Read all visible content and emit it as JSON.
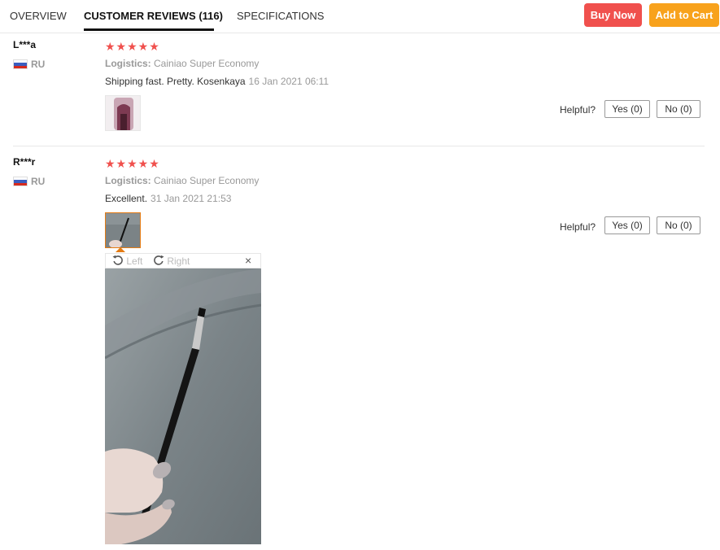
{
  "tabs": [
    {
      "label": "OVERVIEW",
      "active": false
    },
    {
      "label": "CUSTOMER REVIEWS (116)",
      "active": true
    },
    {
      "label": "SPECIFICATIONS",
      "active": false
    }
  ],
  "actions": {
    "buy_now": "Buy Now",
    "add_to_cart": "Add to Cart"
  },
  "colors": {
    "buy_now": "#f0504d",
    "add_to_cart": "#f8a21c",
    "stars": "#f0504d",
    "selected_thumb": "#e47b13"
  },
  "reviews": [
    {
      "user": "L***a",
      "country": "RU",
      "stars": "★★★★★",
      "logistics_label": "Logistics:",
      "logistics_value": "Cainiao Super Economy",
      "text": "Shipping fast. Pretty. Kosenkaya",
      "date": "16 Jan 2021 06:11",
      "helpful_label": "Helpful?",
      "yes": "Yes (0)",
      "no": "No (0)"
    },
    {
      "user": "R***r",
      "country": "RU",
      "stars": "★★★★★",
      "logistics_label": "Logistics:",
      "logistics_value": "Cainiao Super Economy",
      "text": "Excellent.",
      "date": "31 Jan 2021 21:53",
      "helpful_label": "Helpful?",
      "yes": "Yes (0)",
      "no": "No (0)"
    }
  ],
  "viewer": {
    "left": "Left",
    "right": "Right",
    "close": "×"
  }
}
